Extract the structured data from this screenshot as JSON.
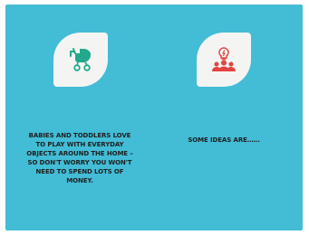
{
  "slide": {
    "background_color": "#43bcd6",
    "left_card": {
      "icon": "baby-stroller-icon",
      "icon_color": "#22a98c",
      "caption": "BABIES AND TODDLERS LOVE TO PLAY WITH EVERYDAY OBJECTS AROUND THE HOME – SO DON'T WORRY YOU WON'T NEED TO SPEND LOTS OF MONEY."
    },
    "right_card": {
      "icon": "idea-group-icon",
      "icon_color": "#e2443f",
      "caption": "SOME IDEAS ARE……"
    }
  }
}
